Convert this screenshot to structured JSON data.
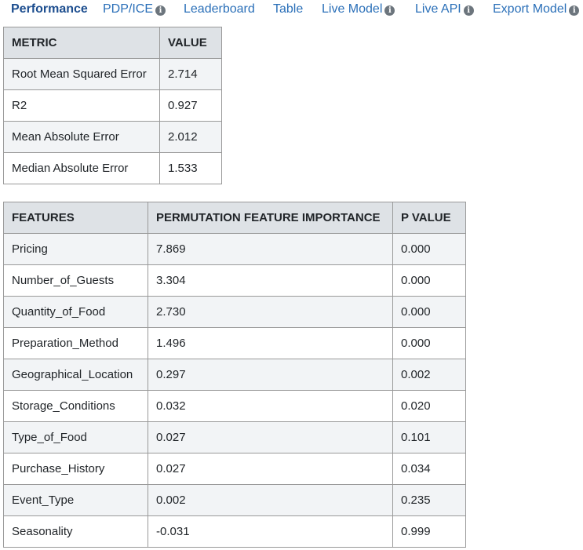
{
  "tabs": [
    {
      "label": "Performance",
      "info": false,
      "active": true
    },
    {
      "label": "PDP/ICE",
      "info": true,
      "active": false
    },
    {
      "label": "Leaderboard",
      "info": false,
      "active": false
    },
    {
      "label": "Table",
      "info": false,
      "active": false
    },
    {
      "label": "Live Model",
      "info": true,
      "active": false
    },
    {
      "label": "Live API",
      "info": true,
      "active": false
    },
    {
      "label": "Export Model",
      "info": true,
      "active": false
    }
  ],
  "metrics_table": {
    "headers": [
      "METRIC",
      "VALUE"
    ],
    "rows": [
      [
        "Root Mean Squared Error",
        "2.714"
      ],
      [
        "R2",
        "0.927"
      ],
      [
        "Mean Absolute Error",
        "2.012"
      ],
      [
        "Median Absolute Error",
        "1.533"
      ]
    ]
  },
  "features_table": {
    "headers": [
      "FEATURES",
      "PERMUTATION FEATURE IMPORTANCE",
      "P VALUE"
    ],
    "rows": [
      [
        "Pricing",
        "7.869",
        "0.000"
      ],
      [
        "Number_of_Guests",
        "3.304",
        "0.000"
      ],
      [
        "Quantity_of_Food",
        "2.730",
        "0.000"
      ],
      [
        "Preparation_Method",
        "1.496",
        "0.000"
      ],
      [
        "Geographical_Location",
        "0.297",
        "0.002"
      ],
      [
        "Storage_Conditions",
        "0.032",
        "0.020"
      ],
      [
        "Type_of_Food",
        "0.027",
        "0.101"
      ],
      [
        "Purchase_History",
        "0.027",
        "0.034"
      ],
      [
        "Event_Type",
        "0.002",
        "0.235"
      ],
      [
        "Seasonality",
        "-0.031",
        "0.999"
      ]
    ]
  }
}
